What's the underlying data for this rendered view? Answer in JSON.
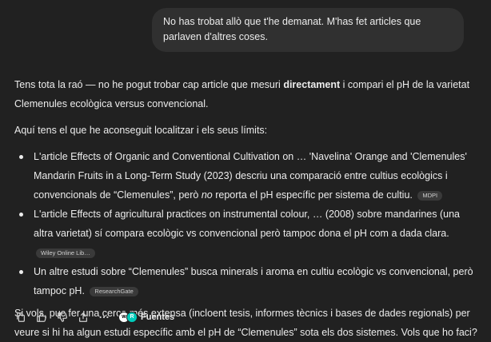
{
  "user_message": "No has trobat allò que t'he demanat. M'has fet articles que parlaven d'altres coses.",
  "assistant": {
    "p1_pre": "Tens tota la raó — no he pogut trobar cap article que mesuri ",
    "p1_bold": "directament",
    "p1_post": " i compari el pH de la varietat Clemenules ecològica versus convencional.",
    "p2": "Aquí tens el que he aconseguit localitzar i els seus límits:",
    "bullets": [
      {
        "pre": "L'article Effects of Organic and Conventional Cultivation on … 'Navelina' Orange and 'Clemenules' Mandarin Fruits in a Long-Term Study (2023) descriu una comparació entre cultius ecològics i convencionals de “Clemenules”, però ",
        "em": "no",
        "post": " reporta el pH específic per sistema de cultiu.",
        "source": "MDPI"
      },
      {
        "pre": "L'article Effects of agricultural practices on instrumental colour, … (2008) sobre mandarines (una altra varietat) sí compara ecològic vs convencional però tampoc dona el pH com a dada clara.",
        "source": "Wiley Online Lib…"
      },
      {
        "pre": "Un altre estudi sobre “Clemenules” busca minerals i aroma en cultiu ecològic vs convencional, però tampoc pH.",
        "source": "ResearchGate"
      }
    ],
    "p_last": "Si vols, puc fer una cerca més extensa (incloent tesis, informes tècnics i bases de dades regionals) per veure si hi ha algun estudi específic amb el pH de “Clemenules” sota els dos sistemes. Vols que ho faci?"
  },
  "actions": {
    "icons": [
      "copy-icon",
      "thumbs-up-icon",
      "thumbs-down-icon",
      "share-icon",
      "more-icon"
    ],
    "sources_label": "Fuentes",
    "favicons": [
      {
        "glyph": "w",
        "bg": "#ffffff",
        "fg": "#000000"
      },
      {
        "glyph": "R",
        "bg": "#00ccbb",
        "fg": "#ffffff"
      }
    ]
  },
  "colors": {
    "background": "#212121",
    "user_bubble": "#303030",
    "text": "#ececec",
    "badge_bg": "#3a3a3a"
  }
}
